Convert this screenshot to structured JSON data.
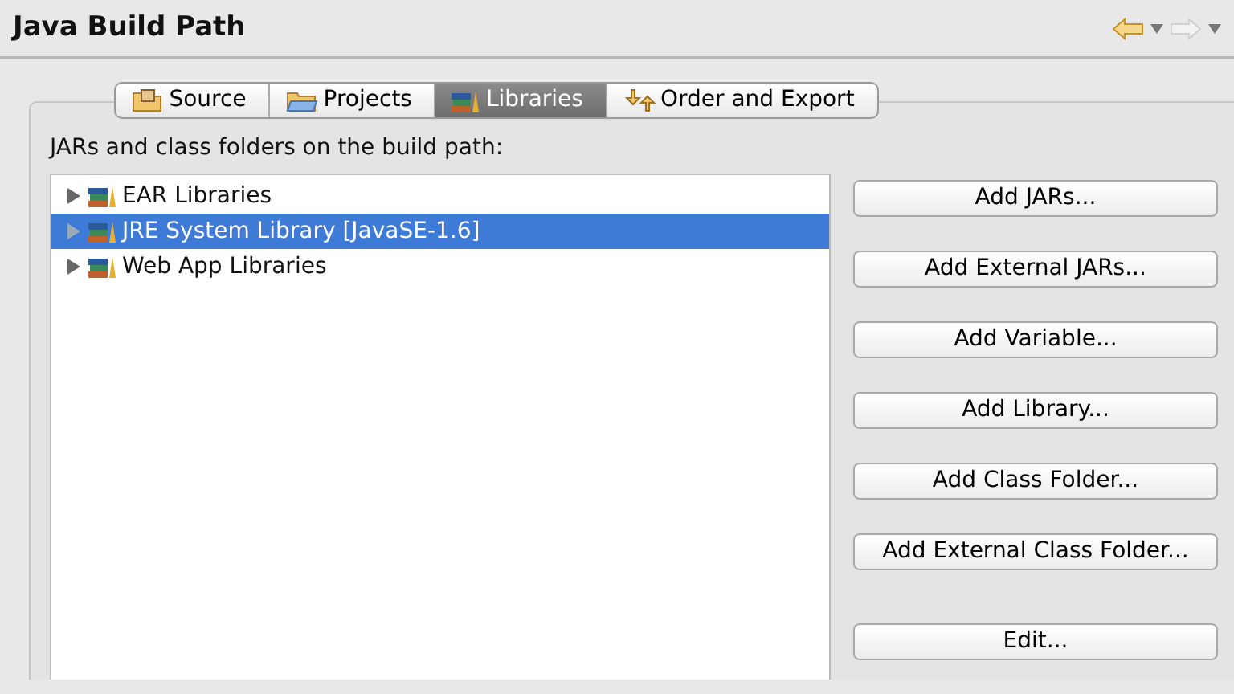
{
  "window": {
    "title": "Java Build Path"
  },
  "tabs": [
    {
      "label": "Source",
      "kind": "source",
      "selected": false
    },
    {
      "label": "Projects",
      "kind": "projects",
      "selected": false
    },
    {
      "label": "Libraries",
      "kind": "libraries",
      "selected": true
    },
    {
      "label": "Order and Export",
      "kind": "order",
      "selected": false
    }
  ],
  "tree": {
    "label": "JARs and class folders on the build path:",
    "items": [
      {
        "label": "EAR Libraries",
        "expanded": false,
        "selected": false
      },
      {
        "label": "JRE System Library [JavaSE-1.6]",
        "expanded": false,
        "selected": true
      },
      {
        "label": "Web App Libraries",
        "expanded": false,
        "selected": false
      }
    ]
  },
  "button_groups": [
    [
      "Add JARs...",
      "Add External JARs...",
      "Add Variable...",
      "Add Library...",
      "Add Class Folder...",
      "Add External Class Folder..."
    ],
    [
      "Edit..."
    ]
  ]
}
